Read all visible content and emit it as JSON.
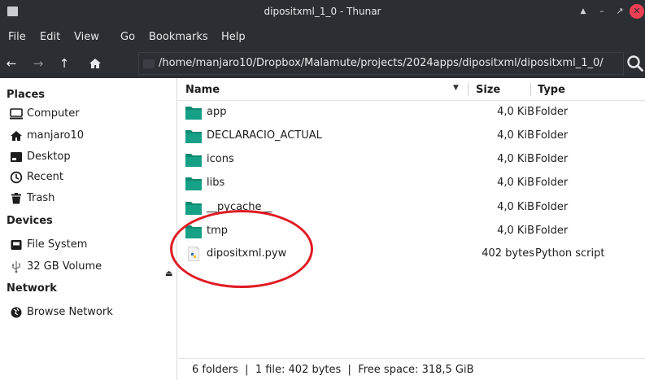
{
  "window": {
    "title": "dipositxml_1_0 - Thunar",
    "controls": [
      "up-arrow-icon",
      "minimize-icon",
      "restore-icon",
      "close-icon"
    ]
  },
  "menubar": {
    "items": [
      "File",
      "Edit",
      "View",
      "Go",
      "Bookmarks",
      "Help"
    ]
  },
  "location": {
    "path": "/home/manjaro10/Dropbox/Malamute/projects/2024apps/dipositxml/dipositxml_1_0/"
  },
  "sidebar": {
    "places_header": "Places",
    "places": [
      {
        "label": "Computer",
        "icon": "computer-icon"
      },
      {
        "label": "manjaro10",
        "icon": "home-icon"
      },
      {
        "label": "Desktop",
        "icon": "desktop-icon"
      },
      {
        "label": "Recent",
        "icon": "clock-icon"
      },
      {
        "label": "Trash",
        "icon": "trash-icon"
      }
    ],
    "devices_header": "Devices",
    "devices": [
      {
        "label": "File System",
        "icon": "drive-icon"
      },
      {
        "label": "32 GB Volume",
        "icon": "usb-icon"
      }
    ],
    "network_header": "Network",
    "network": [
      {
        "label": "Browse Network",
        "icon": "network-icon"
      }
    ]
  },
  "columns": {
    "name": "Name",
    "size": "Size",
    "type": "Type"
  },
  "files": [
    {
      "name": "app",
      "size": "4,0 KiB",
      "type": "Folder",
      "kind": "folder"
    },
    {
      "name": "DECLARACIO_ACTUAL",
      "size": "4,0 KiB",
      "type": "Folder",
      "kind": "folder"
    },
    {
      "name": "icons",
      "size": "4,0 KiB",
      "type": "Folder",
      "kind": "folder"
    },
    {
      "name": "libs",
      "size": "4,0 KiB",
      "type": "Folder",
      "kind": "folder"
    },
    {
      "name": "__pycache__",
      "size": "4,0 KiB",
      "type": "Folder",
      "kind": "folder"
    },
    {
      "name": "tmp",
      "size": "4,0 KiB",
      "type": "Folder",
      "kind": "folder"
    },
    {
      "name": "dipositxml.pyw",
      "size": "402 bytes",
      "type": "Python script",
      "kind": "python"
    }
  ],
  "status": {
    "text": "6 folders  |  1 file: 402 bytes  |  Free space: 318,5 GiB"
  },
  "colors": {
    "chrome_dark": "#2b2e33",
    "folder_teal": "#16a085",
    "close_red": "#ef3f53",
    "annotation_red": "#e01b24"
  }
}
